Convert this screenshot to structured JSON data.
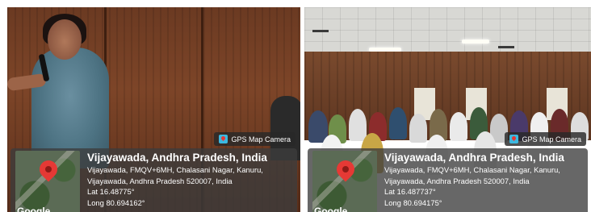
{
  "photos": [
    {
      "gps_tag": "GPS Map Camera",
      "map_label": "Google",
      "title": "Vijayawada, Andhra Pradesh, India",
      "address_line1": "Vijayawada, FMQV+6MH, Chalasani Nagar, Kanuru,",
      "address_line2": "Vijayawada, Andhra Pradesh 520007, India",
      "lat": "Lat 16.48775°",
      "long": "Long 80.694162°"
    },
    {
      "gps_tag": "GPS Map Camera",
      "map_label": "Google",
      "title": "Vijayawada, Andhra Pradesh, India",
      "address_line1": "Vijayawada, FMQV+6MH, Chalasani Nagar, Kanuru,",
      "address_line2": "Vijayawada, Andhra Pradesh 520007, India",
      "lat": "Lat 16.487737°",
      "long": "Long 80.694175°"
    }
  ],
  "icons": {
    "gps_tag_icon": "map-pin-icon",
    "map_pin": "location-pin-icon"
  }
}
